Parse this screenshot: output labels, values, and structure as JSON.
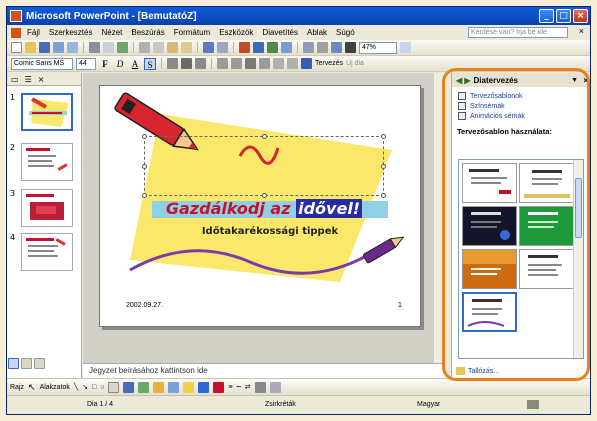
{
  "window": {
    "title": "Microsoft PowerPoint - [BemutatóZ]",
    "controls": [
      "_",
      "□",
      "×"
    ]
  },
  "menubar": {
    "items": [
      "Fájl",
      "Szerkesztés",
      "Nézet",
      "Beszúrás",
      "Formátum",
      "Eszközök",
      "Diavetítés",
      "Ablak",
      "Súgó"
    ],
    "help_placeholder": "Kérdése van? Írja be ide.",
    "close": "×"
  },
  "toolbar_standard": {
    "zoom": "47%",
    "help": "?"
  },
  "toolbar_formatting": {
    "font": "Comic Sans MS",
    "size": "44",
    "bold": "F",
    "italic": "D",
    "underline": "A",
    "shadow": "S",
    "design_button": "Tervezés",
    "new_slide_button": "Új dia"
  },
  "left_pane": {
    "tab_icons": [
      "slides-tab-icon",
      "outline-tab-icon"
    ],
    "close": "×",
    "thumbnails": [
      {
        "number": "1",
        "selected": true
      },
      {
        "number": "2",
        "selected": false
      },
      {
        "number": "3",
        "selected": false
      },
      {
        "number": "4",
        "selected": false
      }
    ]
  },
  "slide": {
    "title_part1": "Gazdálkodj az",
    "title_part2": "idővel!",
    "subtitle": "Időtakarékossági tippek",
    "date": "2002.09.27.",
    "page": "1"
  },
  "notes": {
    "placeholder": "Jegyzet beírásához kattintson ide"
  },
  "task_pane": {
    "title": "Diatervezés",
    "links": [
      "Tervezősablonok",
      "Színsémák",
      "Animációs sémák"
    ],
    "section_title": "Tervezősablon használata:",
    "footer_link": "Tallózás..."
  },
  "drawing_toolbar": {
    "draw_label": "Rajz",
    "autoshapes_label": "Alakzatok"
  },
  "statusbar": {
    "slide_indicator": "Dia 1 / 4",
    "design_name": "Zsirkréták",
    "language": "Magyar"
  },
  "colors": {
    "title_red": "#c8102e",
    "accent_orange": "#e6821d",
    "xp_blue": "#0a5ce0"
  }
}
